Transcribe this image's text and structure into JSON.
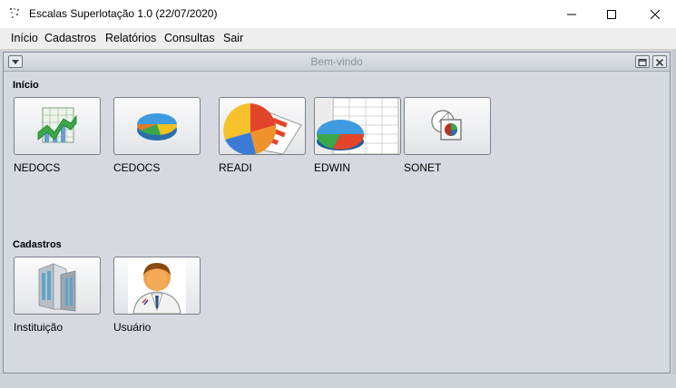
{
  "window": {
    "title": "Escalas Superlotação 1.0 (22/07/2020)",
    "controls": [
      "minimize-icon",
      "maximize-icon",
      "close-icon"
    ]
  },
  "menu": {
    "items": [
      "Início",
      "Cadastros",
      "Relatórios",
      "Consultas",
      "Sair"
    ]
  },
  "internal_frame": {
    "title": "Bem-vindo"
  },
  "sections": {
    "inicio": {
      "label": "Início",
      "items": [
        {
          "label": "NEDOCS",
          "icon": "line-chart-icon"
        },
        {
          "label": "CEDOCS",
          "icon": "pie-chart-icon"
        },
        {
          "label": "READI",
          "icon": "pie-report-icon"
        },
        {
          "label": "EDWIN",
          "icon": "spreadsheet-pie-icon"
        },
        {
          "label": "SONET",
          "icon": "document-chart-icon"
        }
      ]
    },
    "cadastros": {
      "label": "Cadastros",
      "items": [
        {
          "label": "Instituição",
          "icon": "building-icon"
        },
        {
          "label": "Usuário",
          "icon": "doctor-user-icon"
        }
      ]
    }
  },
  "colors": {
    "desktop_bg": "#d6d9df",
    "tile_border": "#7b808a",
    "frame_title_text": "#8e949c"
  }
}
